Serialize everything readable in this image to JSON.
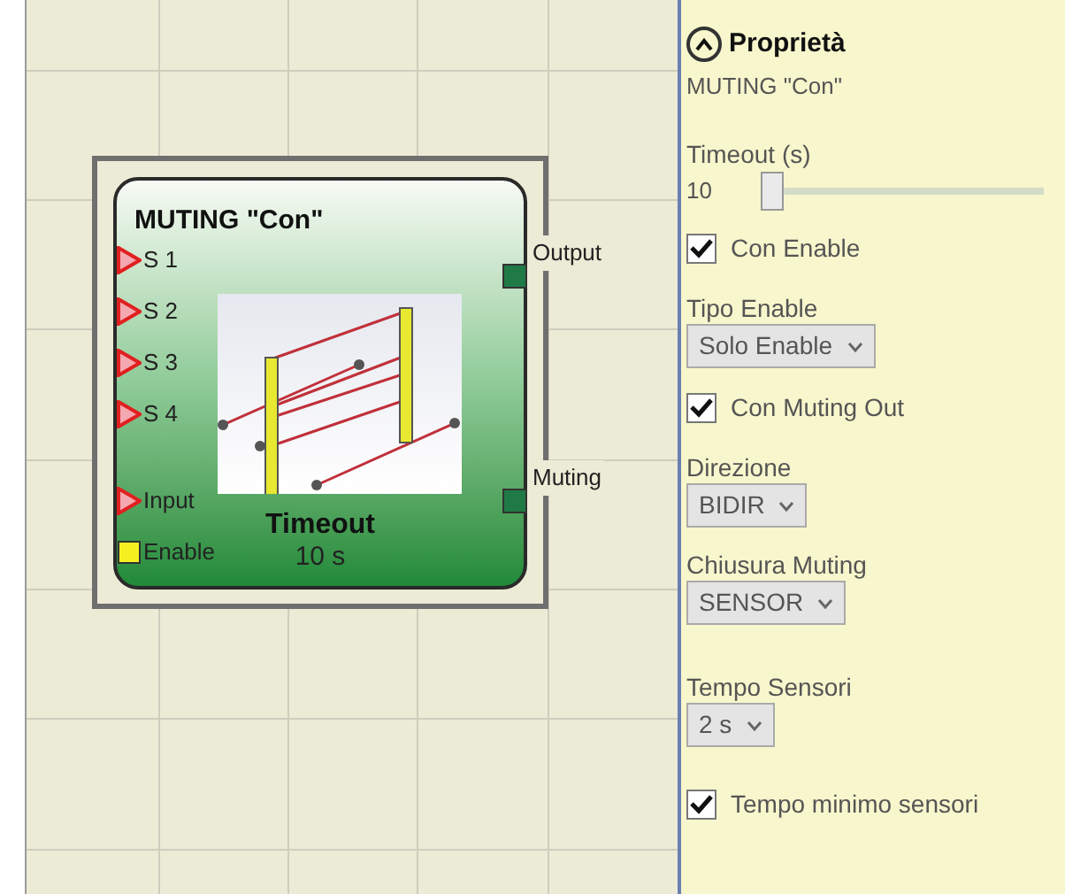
{
  "canvas": {
    "block": {
      "title": "MUTING \"Con\"",
      "inputs": [
        {
          "label": "S 1",
          "kind": "sensor"
        },
        {
          "label": "S 2",
          "kind": "sensor"
        },
        {
          "label": "S 3",
          "kind": "sensor"
        },
        {
          "label": "S 4",
          "kind": "sensor"
        },
        {
          "label": "Input",
          "kind": "sensor"
        },
        {
          "label": "Enable",
          "kind": "enable"
        }
      ],
      "outputs": [
        {
          "label": "Output"
        },
        {
          "label": "Muting"
        }
      ],
      "parameter_label": "Timeout",
      "parameter_value": "10 s"
    }
  },
  "properties": {
    "title": "Proprietà",
    "expanded": true,
    "subtitle": "MUTING \"Con\"",
    "fields": [
      {
        "kind": "slider",
        "label": "Timeout (s)",
        "value": "10",
        "level": 0
      },
      {
        "kind": "checkbox",
        "label": "Con Enable",
        "checked": true
      },
      {
        "kind": "select",
        "label": "Tipo Enable",
        "value": "Solo Enable"
      },
      {
        "kind": "checkbox",
        "label": "Con Muting Out",
        "checked": true
      },
      {
        "kind": "select",
        "label": "Direzione",
        "value": "BIDIR"
      },
      {
        "kind": "select",
        "label": "Chiusura Muting",
        "value": "SENSOR"
      },
      {
        "kind": "select",
        "label": "Tempo Sensori",
        "value": "2 s"
      },
      {
        "kind": "checkbox",
        "label": "Tempo minimo sensori",
        "checked": true
      }
    ]
  }
}
